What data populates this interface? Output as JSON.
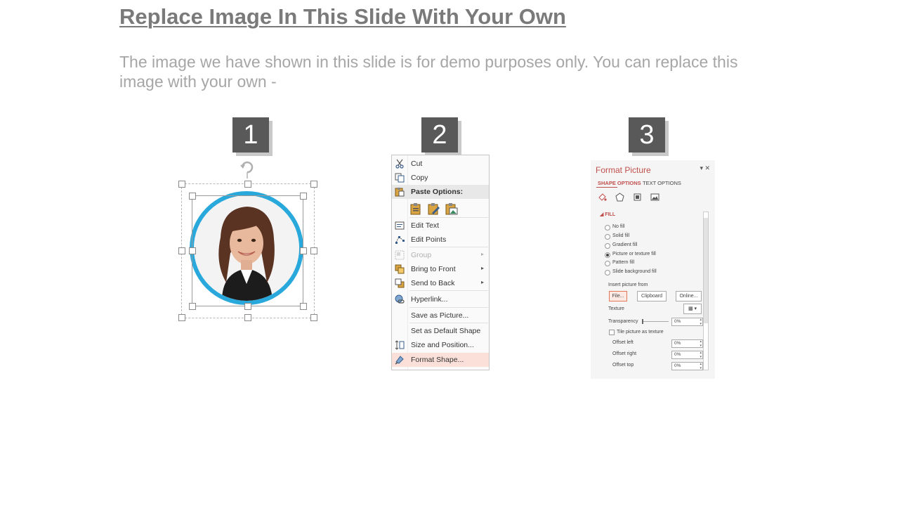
{
  "slide": {
    "title": "Replace Image In This Slide With Your Own",
    "subtitle": "The image we have shown in this slide is for demo purposes only. You can replace this image with your own -"
  },
  "steps": [
    "1",
    "2",
    "3"
  ],
  "context_menu": {
    "items": [
      {
        "label": "Cut",
        "icon": "scissors-icon"
      },
      {
        "label": "Copy",
        "icon": "copy-icon"
      },
      {
        "label": "Paste Options:",
        "icon": "paste-icon"
      },
      {
        "label": "Edit Text",
        "icon": "edit-text-icon"
      },
      {
        "label": "Edit Points",
        "icon": "edit-points-icon"
      },
      {
        "label": "Group",
        "icon": "group-icon"
      },
      {
        "label": "Bring to Front",
        "icon": "bring-front-icon"
      },
      {
        "label": "Send to Back",
        "icon": "send-back-icon"
      },
      {
        "label": "Hyperlink...",
        "icon": "hyperlink-icon"
      },
      {
        "label": "Save as Picture...",
        "icon": ""
      },
      {
        "label": "Set as Default Shape",
        "icon": ""
      },
      {
        "label": "Size and Position...",
        "icon": "size-position-icon"
      },
      {
        "label": "Format Shape...",
        "icon": "format-shape-icon"
      }
    ],
    "submenu_arrow": "▸"
  },
  "format_pane": {
    "title": "Format Picture",
    "tab_shape": "SHAPE OPTIONS",
    "tab_text": "TEXT OPTIONS",
    "fill_header": "FILL",
    "fill_options": [
      "No fill",
      "Solid fill",
      "Gradient fill",
      "Picture or texture fill",
      "Pattern fill",
      "Slide background fill"
    ],
    "insert_from": "Insert picture from",
    "btn_file": "File...",
    "btn_clipboard": "Clipboard",
    "btn_online": "Online...",
    "texture": "Texture",
    "transparency": "Transparency",
    "transparency_value": "0%",
    "tile": "Tile picture as texture",
    "offset_left": "Offset left",
    "offset_right": "Offset right",
    "offset_top": "Offset top",
    "offset_left_value": "0%",
    "offset_right_value": "0%",
    "offset_top_value": "0%",
    "accent_color": "#c0504d"
  },
  "colors": {
    "title": "#7a7a7a",
    "subtitle": "#a6a6a6",
    "badge": "#595959",
    "circle_border": "#29a8dc"
  }
}
